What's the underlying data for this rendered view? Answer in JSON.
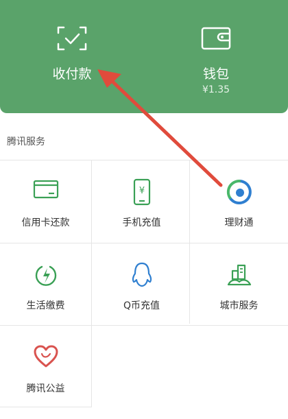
{
  "header": {
    "pay": {
      "label": "收付款",
      "icon": "scan-pay-icon"
    },
    "wallet": {
      "label": "钱包",
      "balance": "¥1.35",
      "icon": "wallet-icon"
    }
  },
  "section": {
    "title": "腾讯服务"
  },
  "services": [
    {
      "label": "信用卡还款",
      "icon": "credit-card-icon"
    },
    {
      "label": "手机充值",
      "icon": "phone-topup-icon"
    },
    {
      "label": "理财通",
      "icon": "wealth-icon"
    },
    {
      "label": "生活缴费",
      "icon": "utility-payment-icon"
    },
    {
      "label": "Q币充值",
      "icon": "qq-coin-icon"
    },
    {
      "label": "城市服务",
      "icon": "city-service-icon"
    },
    {
      "label": "腾讯公益",
      "icon": "charity-heart-icon"
    }
  ],
  "colors": {
    "header_bg": "#5aa36a",
    "icon_green": "#3aa055",
    "arrow_red": "#e04b3c"
  }
}
